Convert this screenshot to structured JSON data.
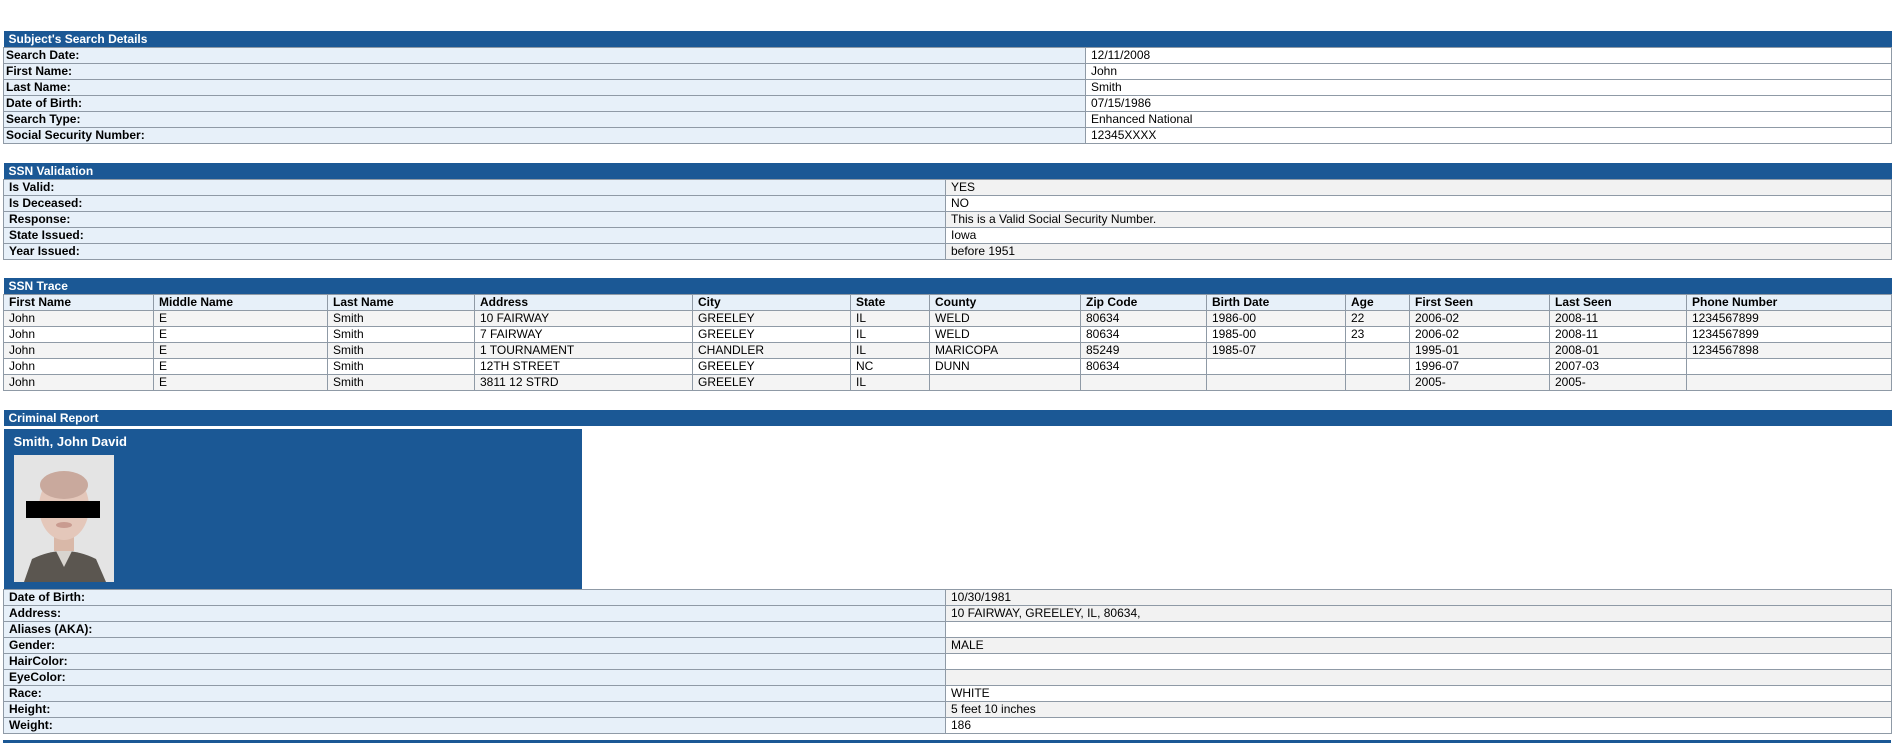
{
  "subject": {
    "title": "Subject's Search Details",
    "rows": [
      {
        "label": "Search Date:",
        "value": "12/11/2008"
      },
      {
        "label": "First Name:",
        "value": "John"
      },
      {
        "label": "Last Name:",
        "value": "Smith"
      },
      {
        "label": "Date of Birth:",
        "value": "07/15/1986"
      },
      {
        "label": "Search Type:",
        "value": "Enhanced National"
      },
      {
        "label": "Social Security Number:",
        "value": "12345XXXX"
      }
    ]
  },
  "ssn_validation": {
    "title": "SSN Validation",
    "rows": [
      {
        "label": "Is Valid:",
        "value": "YES"
      },
      {
        "label": "Is Deceased:",
        "value": "NO"
      },
      {
        "label": "Response:",
        "value": "This is a Valid Social Security Number."
      },
      {
        "label": "State Issued:",
        "value": "Iowa"
      },
      {
        "label": "Year Issued:",
        "value": "before 1951"
      }
    ]
  },
  "ssn_trace": {
    "title": "SSN Trace",
    "headers": [
      "First Name",
      "Middle Name",
      "Last Name",
      "Address",
      "City",
      "State",
      "County",
      "Zip Code",
      "Birth Date",
      "Age",
      "First Seen",
      "Last Seen",
      "Phone Number"
    ],
    "rows": [
      [
        "John",
        "E",
        "Smith",
        "10 FAIRWAY",
        "GREELEY",
        "IL",
        "WELD",
        "80634",
        "1986-00",
        "22",
        "2006-02",
        "2008-11",
        "1234567899"
      ],
      [
        "John",
        "E",
        "Smith",
        "7 FAIRWAY",
        "GREELEY",
        "IL",
        "WELD",
        "80634",
        "1985-00",
        "23",
        "2006-02",
        "2008-11",
        "1234567899"
      ],
      [
        "John",
        "E",
        "Smith",
        "1 TOURNAMENT",
        "CHANDLER",
        "IL",
        "MARICOPA",
        "85249",
        "1985-07",
        "",
        "1995-01",
        "2008-01",
        "1234567898"
      ],
      [
        "John",
        "E",
        "Smith",
        "12TH STREET",
        "GREELEY",
        "NC",
        "DUNN",
        "80634",
        "",
        "",
        "1996-07",
        "2007-03",
        ""
      ],
      [
        "John",
        "E",
        "Smith",
        "3811 12 STRD",
        "GREELEY",
        "IL",
        "",
        "",
        "",
        "",
        "2005-",
        "2005-",
        ""
      ]
    ]
  },
  "criminal": {
    "title": "Criminal Report",
    "name": "Smith, John David",
    "rows": [
      {
        "label": "Date of Birth:",
        "value": "10/30/1981"
      },
      {
        "label": "Address:",
        "value": "10 FAIRWAY, GREELEY, IL, 80634,"
      },
      {
        "label": "Aliases (AKA):",
        "value": ""
      },
      {
        "label": "Gender:",
        "value": "MALE"
      },
      {
        "label": "HairColor:",
        "value": ""
      },
      {
        "label": "EyeColor:",
        "value": ""
      },
      {
        "label": "Race:",
        "value": "WHITE"
      },
      {
        "label": "Height:",
        "value": "5 feet 10 inches"
      },
      {
        "label": "Weight:",
        "value": "186"
      }
    ]
  },
  "colors": {
    "header_blue": "#1b5895",
    "label_bg": "#e7f0f9"
  },
  "icons": {
    "photo": "redacted-mugshot-photo"
  }
}
